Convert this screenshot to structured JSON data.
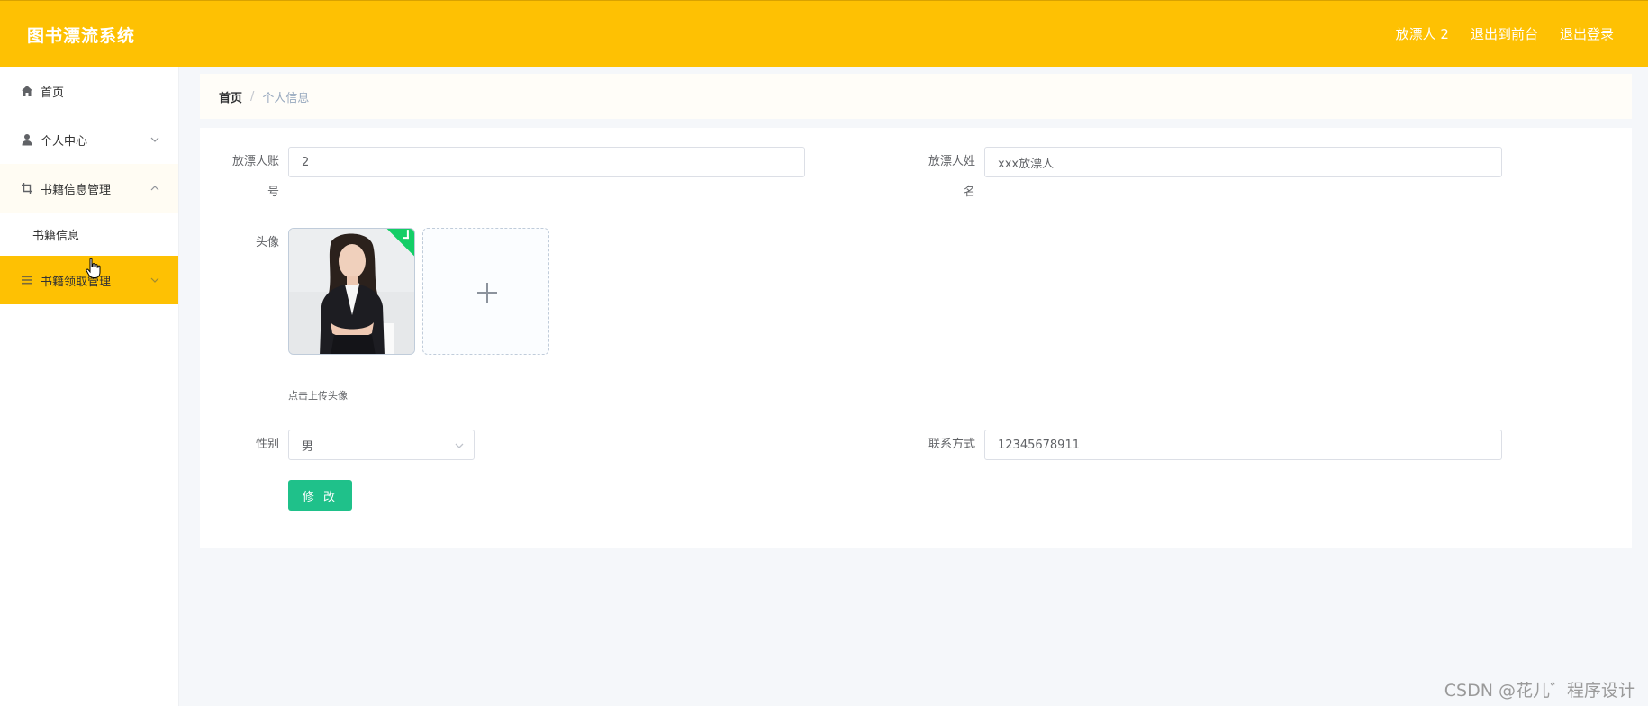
{
  "header": {
    "app_title": "图书漂流系统",
    "user_label": "放漂人 2",
    "front_link": "退出到前台",
    "logout_link": "退出登录"
  },
  "sidebar": {
    "items": [
      {
        "label": "首页",
        "icon": "home-icon"
      },
      {
        "label": "个人中心",
        "icon": "user-icon"
      },
      {
        "label": "书籍信息管理",
        "icon": "crop-icon"
      },
      {
        "label": "书籍信息"
      },
      {
        "label": "书籍领取管理",
        "icon": "list-icon"
      }
    ]
  },
  "breadcrumb": {
    "home": "首页",
    "separator": "/",
    "current": "个人信息"
  },
  "form": {
    "account_label_line1": "放漂人账",
    "account_label_line2": "号",
    "account_value": "2",
    "name_label_line1": "放漂人姓",
    "name_label_line2": "名",
    "name_value": "xxx放漂人",
    "avatar_label": "头像",
    "upload_hint": "点击上传头像",
    "gender_label": "性别",
    "gender_value": "男",
    "contact_label": "联系方式",
    "contact_value": "12345678911",
    "submit_label": "修 改"
  },
  "watermark": "CSDN @花儿゛程序设计",
  "colors": {
    "brand": "#fec103",
    "submit": "#1fc18a",
    "success_badge": "#13ce66"
  }
}
